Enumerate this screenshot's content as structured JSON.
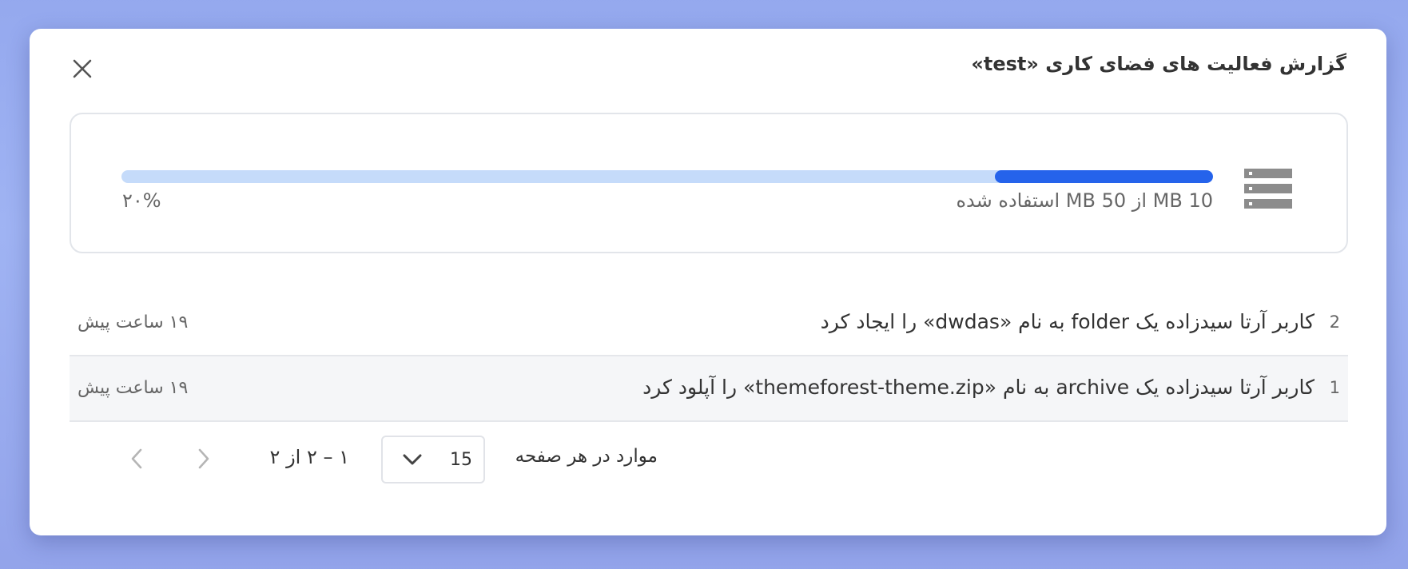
{
  "modal": {
    "title": "گزارش فعالیت های فضای کاری «test»"
  },
  "storage": {
    "used_text": "10 MB از 50 MB استفاده شده",
    "percent_text": "۲۰%",
    "used_fraction": 0.2,
    "icon": "storage-icon"
  },
  "activities": [
    {
      "index": "2",
      "text": "کاربر آرتا سیدزاده یک folder به نام «dwdas» را ایجاد کرد",
      "time": "۱۹ ساعت پیش"
    },
    {
      "index": "1",
      "text": "کاربر آرتا سیدزاده یک archive به نام «themeforest-theme.zip» را آپلود کرد",
      "time": "۱۹ ساعت پیش"
    }
  ],
  "pagination": {
    "per_page_label": "موارد در هر صفحه",
    "per_page_value": "15",
    "range_text": "۱ – ۲ از ۲"
  },
  "colors": {
    "accent": "#2563eb",
    "track": "#c5dbfa",
    "backdrop": "#9fb3f2"
  }
}
